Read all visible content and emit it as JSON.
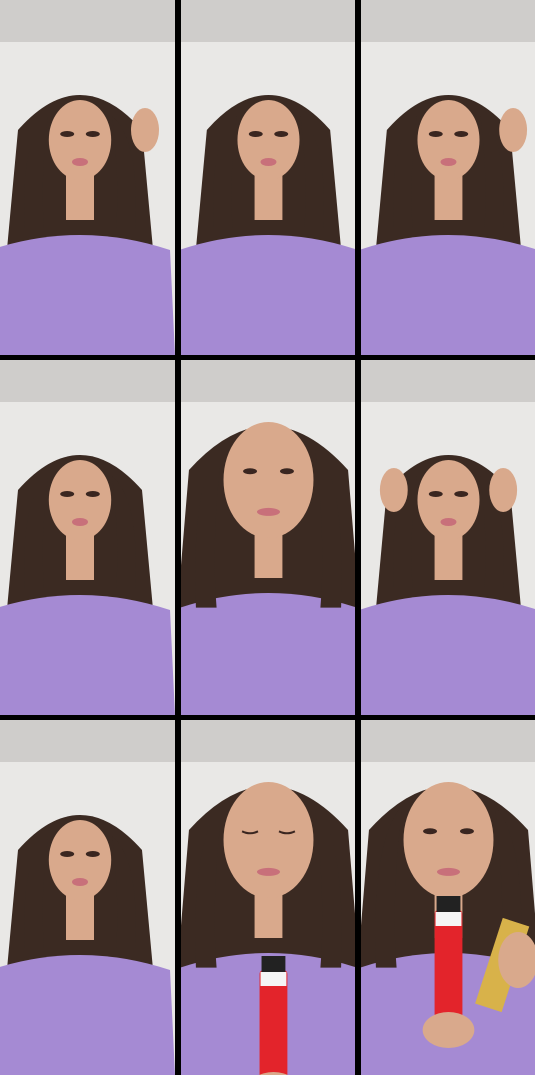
{
  "grid": {
    "rows": 3,
    "columns": 3,
    "frames": [
      {
        "label": "frame-1",
        "pose": "hand-raised-right",
        "object": "none"
      },
      {
        "label": "frame-2",
        "pose": "facing-camera",
        "object": "none"
      },
      {
        "label": "frame-3",
        "pose": "hand-at-hair",
        "object": "none"
      },
      {
        "label": "frame-4",
        "pose": "facing-camera",
        "object": "none"
      },
      {
        "label": "frame-5",
        "pose": "close-up",
        "object": "none"
      },
      {
        "label": "frame-6",
        "pose": "hands-on-head",
        "object": "none"
      },
      {
        "label": "frame-7",
        "pose": "facing-camera",
        "object": "none"
      },
      {
        "label": "frame-8",
        "pose": "close-up-eyes-closed",
        "object": "red-lighter"
      },
      {
        "label": "frame-9",
        "pose": "close-up",
        "object": "red-lighter-and-gold-box"
      }
    ]
  },
  "colors": {
    "background": "#000000",
    "wall": "#e9e8e6",
    "ceiling": "#cfcdcb",
    "shirt": "#a58ad3",
    "hair": "#3b2a22",
    "skin": "#d9a98c",
    "lips": "#c8707a",
    "lighter": "#e3242b",
    "box": "#d8b24a"
  }
}
